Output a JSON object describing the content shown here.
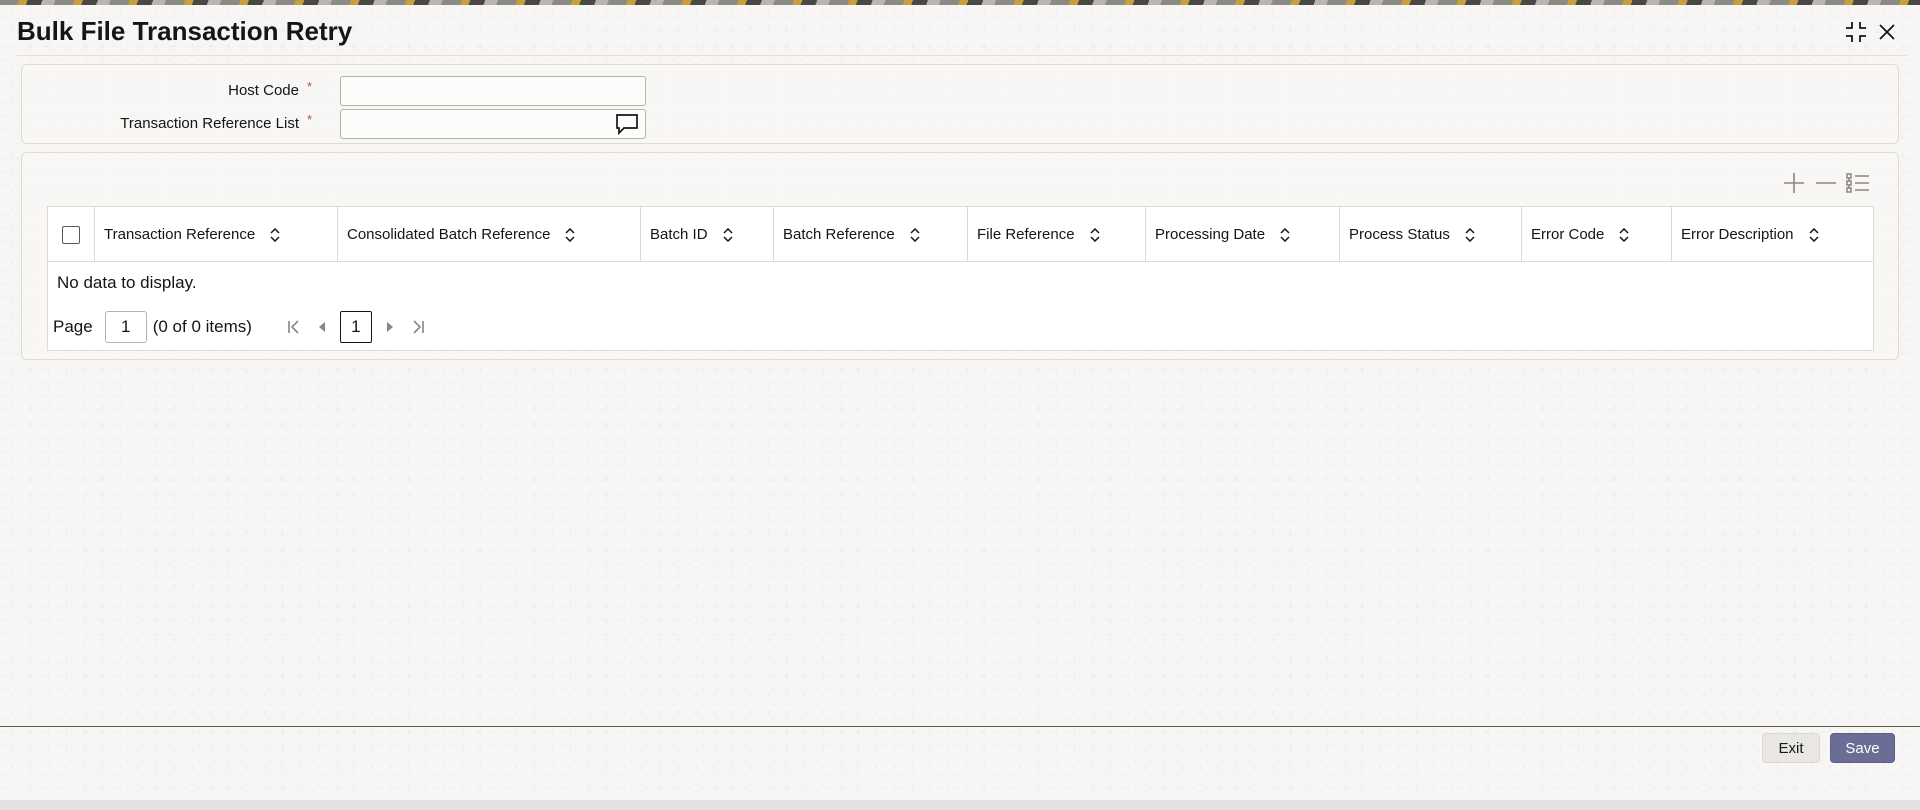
{
  "window": {
    "title": "Bulk File Transaction Retry",
    "controls": {
      "maximize_icon": "collapse-corners-icon",
      "close_icon": "close-icon"
    }
  },
  "form": {
    "host_code": {
      "label": "Host Code",
      "required_mark": "*",
      "value": ""
    },
    "transaction_reference_list": {
      "label": "Transaction Reference List",
      "required_mark": "*",
      "value": "",
      "icon": "chat-bubble-icon"
    }
  },
  "grid": {
    "toolbar": {
      "add_icon": "plus-icon",
      "remove_icon": "minus-icon",
      "columns_icon": "list-columns-icon"
    },
    "columns": [
      "Transaction Reference",
      "Consolidated Batch Reference",
      "Batch ID",
      "Batch Reference",
      "File Reference",
      "Processing Date",
      "Process Status",
      "Error Code",
      "Error Description"
    ],
    "empty_message": "No data to display.",
    "pagination": {
      "page_label": "Page",
      "page_value": "1",
      "items_summary": "(0 of 0 items)",
      "current_page": "1"
    }
  },
  "footer": {
    "exit_label": "Exit",
    "save_label": "Save"
  },
  "colors": {
    "required": "#c74634",
    "save_button": "#6a6e96"
  }
}
